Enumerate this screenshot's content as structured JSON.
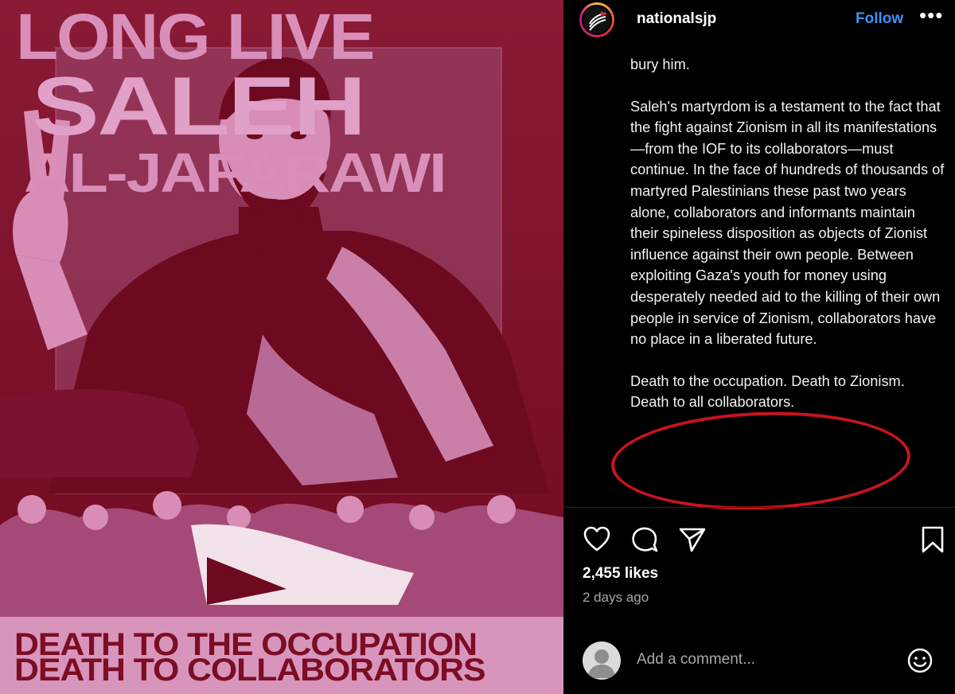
{
  "poster": {
    "title_line1": "LONG LIVE",
    "title_line2": "SALEH",
    "title_line3": "AL-JAFARAWI",
    "bottom_line1": "DEATH TO THE OCCUPATION",
    "bottom_line2": "DEATH TO COLLABORATORS"
  },
  "post": {
    "username": "nationalsjp",
    "follow_label": "Follow",
    "more_label": "•••",
    "caption": {
      "para1": "bury him.",
      "para2": "Saleh's martyrdom is a testament to the fact that the fight against Zionism in all its manifestations—from the IOF to its collaborators—must continue. In the face of hundreds of thousands of martyred Palestinians these past two years alone, collaborators and informants maintain their spineless disposition as objects of Zionist influence against their own people. Between exploiting Gaza's youth for money using desperately needed aid to the killing of their own people in service of Zionism, collaborators have no place in a liberated future.",
      "para3": "Death to the occupation. Death to Zionism. Death to all collaborators."
    },
    "likes": "2,455 likes",
    "time_ago": "2 days ago",
    "comment_placeholder": "Add a comment..."
  },
  "icons": [
    "heart-icon",
    "comment-icon",
    "share-icon",
    "bookmark-icon",
    "emoji-icon"
  ],
  "colors": {
    "follow": "#3f91f5",
    "poster_bg": "#7c0d24",
    "poster_pink": "#d98fb9",
    "highlight": "#c8141c"
  }
}
